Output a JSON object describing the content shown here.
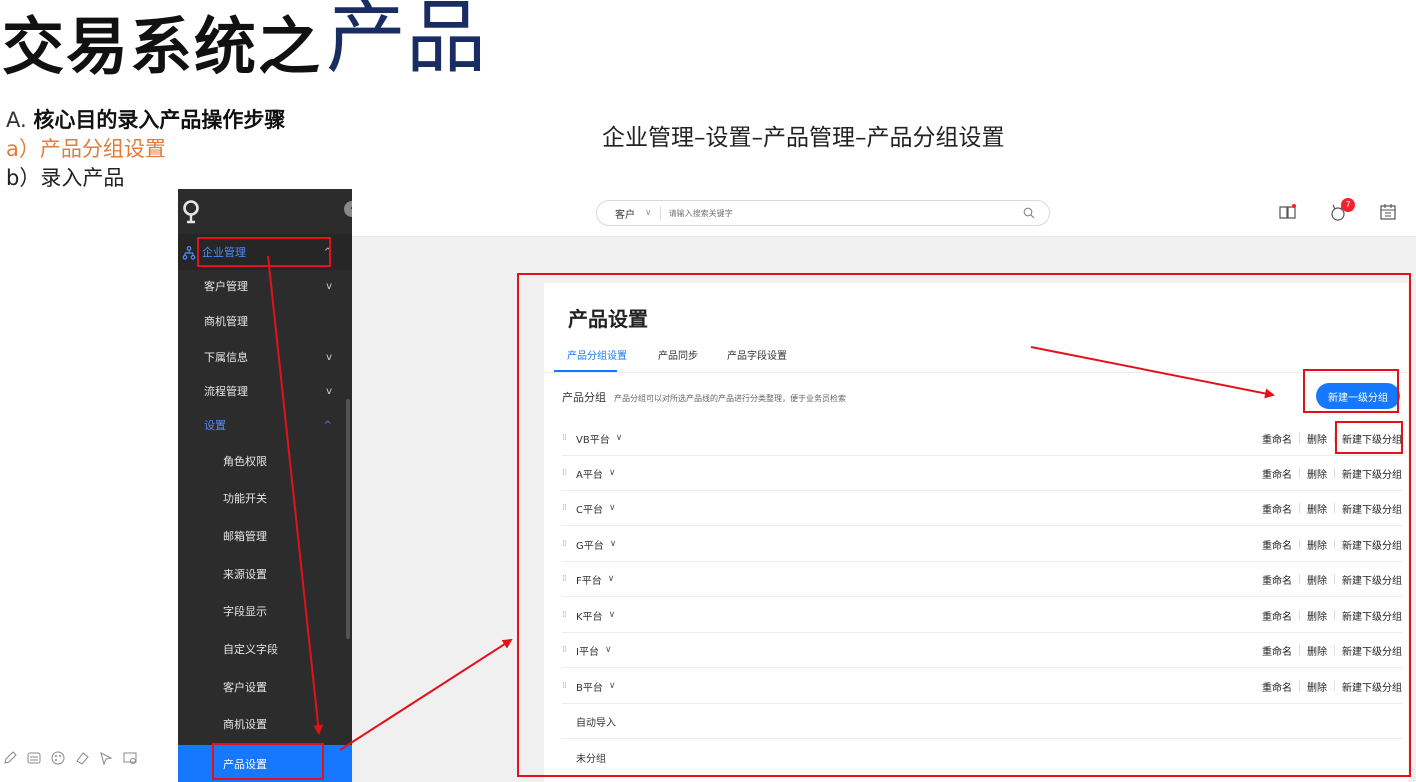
{
  "slide": {
    "title_main": "交易系统之",
    "title_accent": "产品",
    "outline": {
      "a_label": "A.",
      "a_text": "核心目的录入产品操作步骤",
      "b_text": "a）产品分组设置",
      "c_text": "b）录入产品"
    },
    "path_caption": "企业管理–设置–产品管理–产品分组设置"
  },
  "sidebar": {
    "items": [
      {
        "label": "企业管理",
        "chevron": "^"
      },
      {
        "label": "客户管理",
        "chevron": "v"
      },
      {
        "label": "商机管理"
      },
      {
        "label": "下属信息",
        "chevron": "v"
      },
      {
        "label": "流程管理",
        "chevron": "v"
      },
      {
        "label": "设置",
        "chevron": "^"
      },
      {
        "label": "角色权限"
      },
      {
        "label": "功能开关"
      },
      {
        "label": "邮箱管理"
      },
      {
        "label": "来源设置"
      },
      {
        "label": "字段显示"
      },
      {
        "label": "自定义字段"
      },
      {
        "label": "客户设置"
      },
      {
        "label": "商机设置"
      },
      {
        "label": "产品设置"
      }
    ]
  },
  "topbar": {
    "search_scope": "客户",
    "search_placeholder": "请输入搜索关键字",
    "notification_count": "7"
  },
  "main": {
    "page_title": "产品设置",
    "tabs": [
      {
        "label": "产品分组设置",
        "active": true
      },
      {
        "label": "产品同步"
      },
      {
        "label": "产品字段设置"
      }
    ],
    "section_title": "产品分组",
    "section_hint": "产品分组可以对所选产品线的产品进行分类整理，便于业务员检索",
    "new_group_label": "新建一级分组",
    "actions": {
      "rename": "重命名",
      "delete": "删除",
      "add_child": "新建下级分组"
    },
    "groups": [
      {
        "name": "VB平台"
      },
      {
        "name": "A平台"
      },
      {
        "name": "C平台"
      },
      {
        "name": "G平台"
      },
      {
        "name": "F平台"
      },
      {
        "name": "K平台"
      },
      {
        "name": "I平台"
      },
      {
        "name": "B平台"
      }
    ],
    "special_groups": [
      {
        "name": "自动导入"
      },
      {
        "name": "未分组"
      }
    ]
  },
  "colors": {
    "accent": "#1677ff",
    "sidebar_bg": "#2c2c2c",
    "annotation": "#e3121a",
    "title_accent": "#1a2d63",
    "outline_highlight": "#e07d3b"
  }
}
